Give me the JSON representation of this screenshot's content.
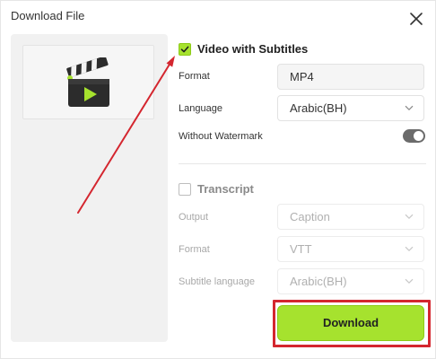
{
  "dialog": {
    "title": "Download File"
  },
  "video_section": {
    "checkbox_label": "Video with Subtitles",
    "checked": true,
    "format_label": "Format",
    "format_value": "MP4",
    "language_label": "Language",
    "language_value": "Arabic(BH)",
    "watermark_label": "Without Watermark",
    "watermark_on": true
  },
  "transcript_section": {
    "checkbox_label": "Transcript",
    "checked": false,
    "output_label": "Output",
    "output_value": "Caption",
    "format_label": "Format",
    "format_value": "VTT",
    "subtitle_language_label": "Subtitle language",
    "subtitle_language_value": "Arabic(BH)"
  },
  "actions": {
    "download_label": "Download"
  },
  "colors": {
    "accent": "#a6e22e",
    "highlight": "#d4262f",
    "annotation_arrow": "#d4262f"
  },
  "icons": [
    "close-icon",
    "clapperboard-icon",
    "check-icon",
    "chevron-down-icon"
  ]
}
